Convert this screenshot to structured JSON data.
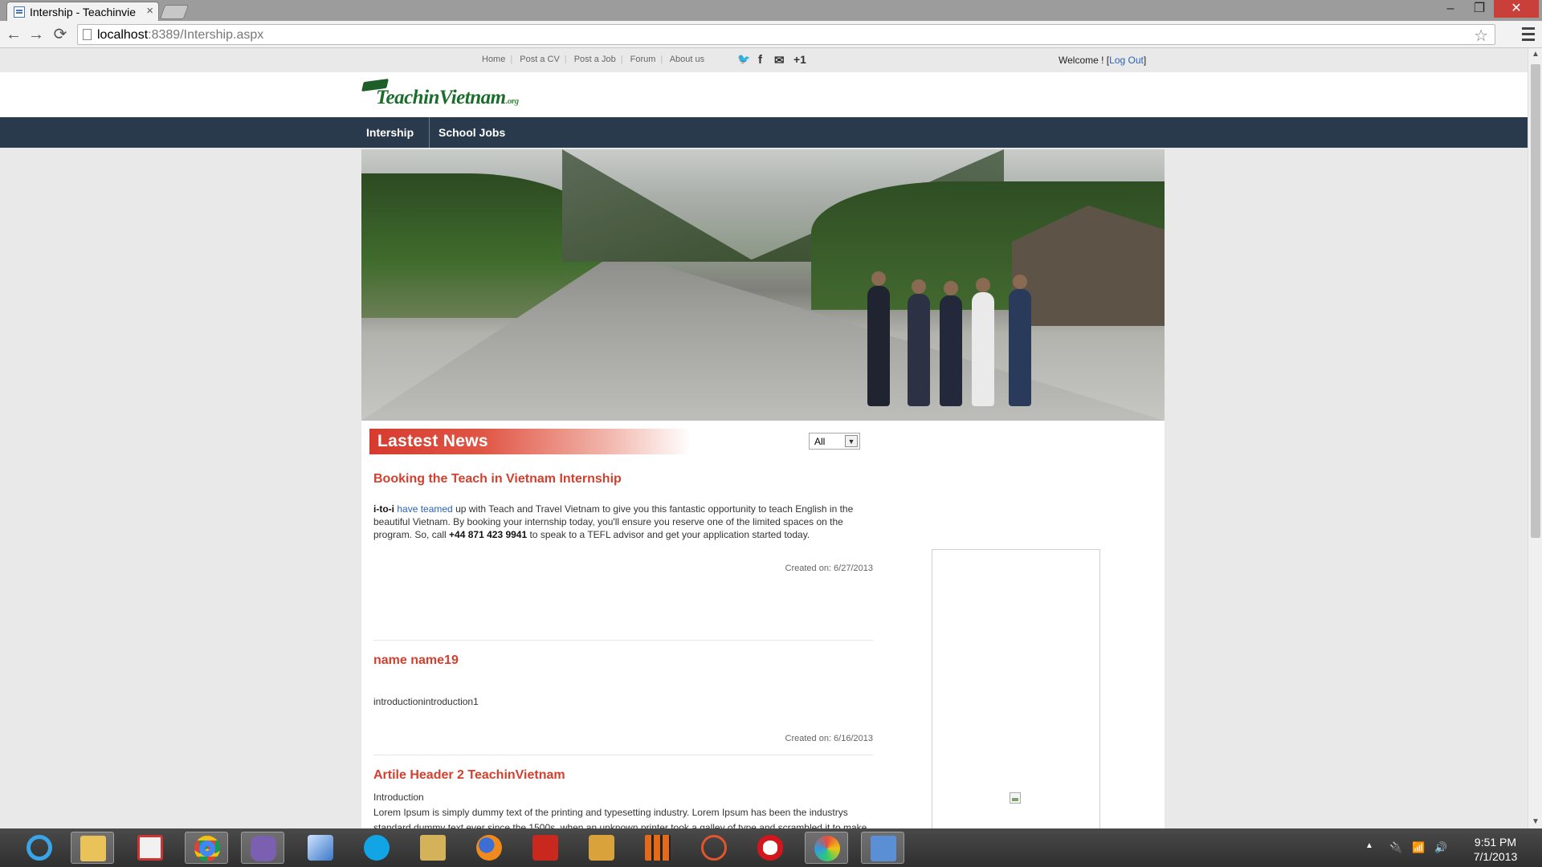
{
  "browser": {
    "tab_title": "Intership - Teachinvie",
    "tab_close": "×",
    "url_host": "localhost",
    "url_rest": ":8389/Intership.aspx",
    "controls": {
      "back": "←",
      "forward": "→",
      "reload": "⟳",
      "minimize": "–",
      "restore": "❐",
      "close": "✕"
    }
  },
  "topbar": {
    "links": [
      "Home",
      "Post a CV",
      "Post a Job",
      "Forum",
      "About us"
    ],
    "social": {
      "twitter": "🐦",
      "facebook": "f",
      "email": "✉",
      "plusone": "+1"
    },
    "welcome_prefix": "Welcome ! [",
    "logout": "Log Out",
    "welcome_suffix": "]"
  },
  "logo": {
    "text": "TeachinVietnam",
    "suffix": ".org"
  },
  "nav": {
    "items": [
      "Intership",
      "School Jobs"
    ]
  },
  "news": {
    "header": "Lastest News",
    "filter_value": "All",
    "articles": [
      {
        "title": "Booking the Teach in Vietnam Internship",
        "lead_bold": "i-to-i",
        "lead_link": "have teamed",
        "body_a": "up with Teach and Travel Vietnam to give you this fantastic opportunity to teach English in the beautiful Vietnam. By booking your internship today, you'll ensure you reserve one of the limited spaces on the program. So, call",
        "phone": "+44 871 423 9941",
        "body_b": "to speak to a TEFL advisor and get your application started today.",
        "date": "Created on: 6/27/2013"
      },
      {
        "title": "name name19",
        "body": "introductionintroduction1",
        "date": "Created on: 6/16/2013"
      },
      {
        "title": "Artile Header 2 TeachinVietnam",
        "intro": "Introduction",
        "body": "Lorem Ipsum is simply dummy text of the printing and typesetting industry. Lorem Ipsum has been the industrys standard dummy text ever since the 1500s, when an unknown printer took a galley of type and scrambled it to make a type specimen book. It has survived not only five centuries, but also the leap into electronic typesetting, remaining essentially unchanged. It was popularised in the 1960s with the release of Letraset sheets containing Lorem Ipsum passages, and more recently with desktop publishing software like Aldus PageMaker including"
      }
    ]
  },
  "taskbar": {
    "apps": [
      "internet-explorer",
      "file-explorer",
      "unikey",
      "chrome",
      "visual-studio",
      "virtualbox",
      "skype",
      "tools",
      "firefox",
      "filezilla",
      "game",
      "sublime-like",
      "xampp",
      "opera",
      "paint"
    ],
    "clock_time": "9:51 PM",
    "clock_date": "7/1/2013"
  },
  "colors": {
    "accent": "#d3402f",
    "nav_bg": "#283a4b",
    "link": "#2a62b7"
  }
}
